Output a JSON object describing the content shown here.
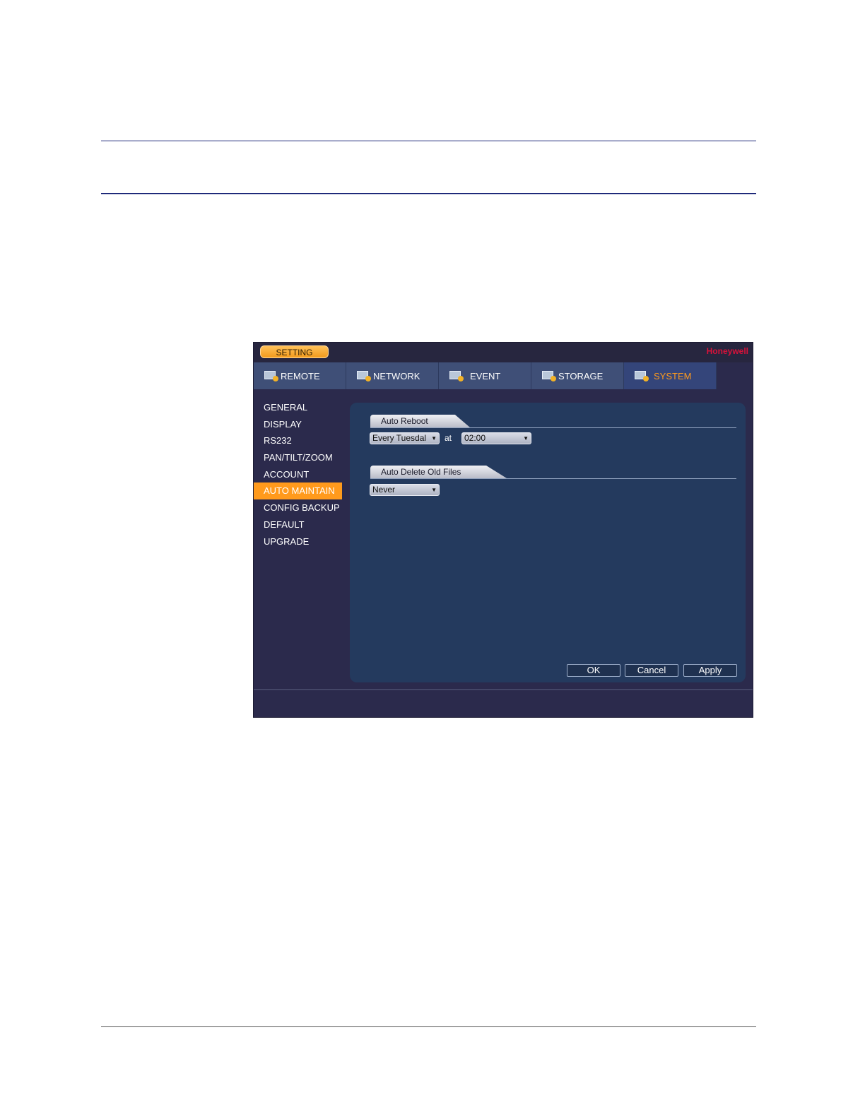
{
  "window": {
    "setting_label": "SETTING",
    "brand": "Honeywell"
  },
  "tabs": [
    {
      "label": "REMOTE",
      "icon": "remote-icon"
    },
    {
      "label": "NETWORK",
      "icon": "network-icon"
    },
    {
      "label": "EVENT",
      "icon": "event-icon"
    },
    {
      "label": "STORAGE",
      "icon": "storage-icon"
    },
    {
      "label": "SYSTEM",
      "icon": "system-icon",
      "active": true
    }
  ],
  "sidebar": {
    "items": [
      {
        "label": "GENERAL"
      },
      {
        "label": "DISPLAY"
      },
      {
        "label": "RS232"
      },
      {
        "label": "PAN/TILT/ZOOM"
      },
      {
        "label": "ACCOUNT"
      },
      {
        "label": "AUTO MAINTAIN",
        "active": true
      },
      {
        "label": "CONFIG BACKUP"
      },
      {
        "label": "DEFAULT"
      },
      {
        "label": "UPGRADE"
      }
    ]
  },
  "auto_reboot": {
    "section_label": "Auto Reboot",
    "day_value": "Every Tuesdal",
    "at_label": "at",
    "time_value": "02:00"
  },
  "auto_delete": {
    "section_label": "Auto Delete Old Files",
    "value": "Never"
  },
  "buttons": {
    "ok": "OK",
    "cancel": "Cancel",
    "apply": "Apply"
  },
  "colors": {
    "accent": "#ff9a1c",
    "brand": "#d8123a",
    "panel": "#243a5e"
  }
}
